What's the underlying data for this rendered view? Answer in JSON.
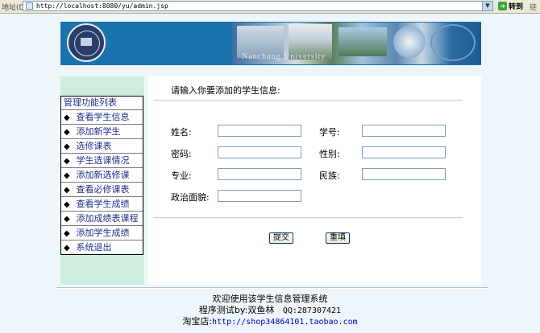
{
  "address_bar": {
    "label": "地址(D)",
    "url": "http://localhost:8080/yu/admin.jsp",
    "go_label": "转到",
    "links_label": "链"
  },
  "banner": {
    "university_text": "Nanchang University"
  },
  "sidebar": {
    "title": "管理功能列表",
    "bullet": "◆",
    "items": [
      {
        "label": "查看学生信息"
      },
      {
        "label": "添加新学生"
      },
      {
        "label": "选修课表"
      },
      {
        "label": "学生选课情况"
      },
      {
        "label": "添加新选修课"
      },
      {
        "label": "查看必修课表"
      },
      {
        "label": "查看学生成绩"
      },
      {
        "label": "添加成绩表课程"
      },
      {
        "label": "添加学生成绩"
      },
      {
        "label": "系统退出"
      }
    ]
  },
  "form": {
    "prompt": "请输入你要添加的学生信息:",
    "fields": {
      "name": {
        "label": "姓名:",
        "value": ""
      },
      "student_id": {
        "label": "学号:",
        "value": ""
      },
      "password": {
        "label": "密码:",
        "value": ""
      },
      "gender": {
        "label": "性别:",
        "value": ""
      },
      "major": {
        "label": "专业:",
        "value": ""
      },
      "ethnicity": {
        "label": "民族:",
        "value": ""
      },
      "political_status": {
        "label": "政治面貌:",
        "value": ""
      }
    },
    "submit_label": "提交",
    "reset_label": "重填"
  },
  "footer": {
    "welcome": "欢迎使用该学生信息管理系统",
    "tester_label": "程序测试by:",
    "tester_name": "双鱼林",
    "qq": "QQ:287307421",
    "shop_label": "淘宝店:",
    "shop_url": "http://shop34864101.taobao.com"
  }
}
